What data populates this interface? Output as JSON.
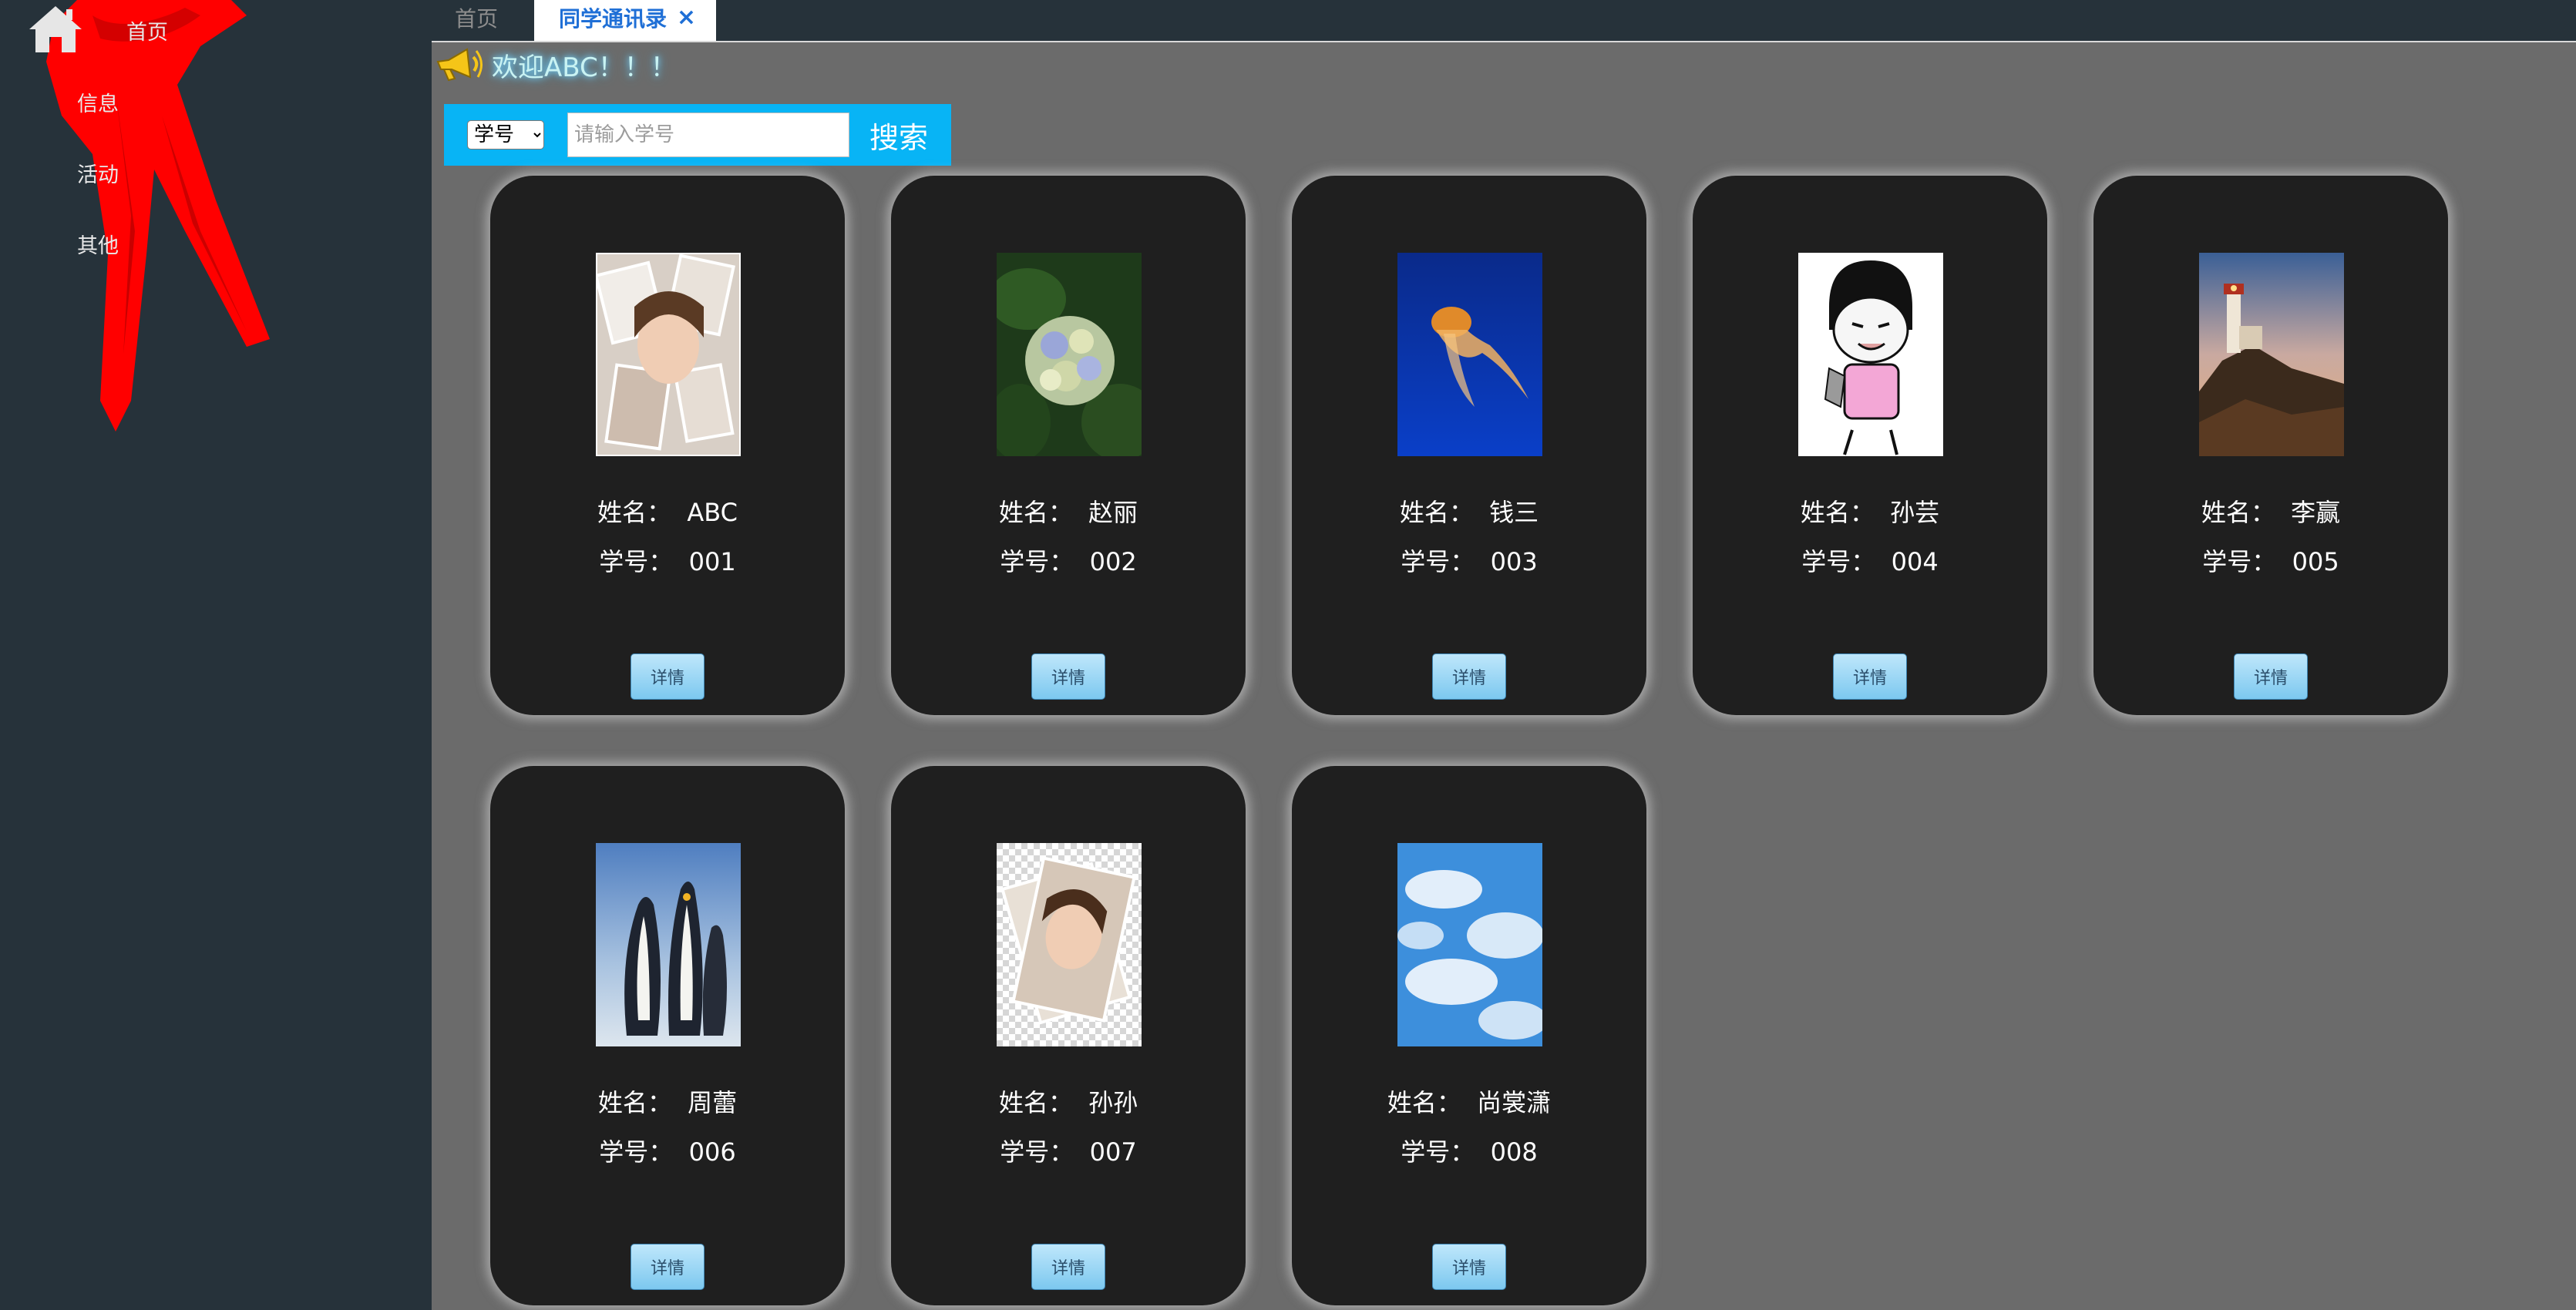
{
  "sidebar": {
    "items": [
      {
        "label": "首页"
      },
      {
        "label": "信息"
      },
      {
        "label": "活动"
      },
      {
        "label": "其他"
      }
    ]
  },
  "tabs": {
    "home": "首页",
    "active": "同学通讯录",
    "close": "×"
  },
  "welcome": {
    "text": "欢迎ABC！！！"
  },
  "search": {
    "field_options": [
      "学号"
    ],
    "selected": "学号",
    "placeholder": "请输入学号",
    "button": "搜索"
  },
  "colors": {
    "sidebar_bg": "#26323a",
    "main_bg": "#6b6b6b",
    "card_bg": "#1f1f1f",
    "search_bar_bg": "#08b4f5",
    "active_tab_text": "#1f6fd6",
    "scarf_red": "#ff0000"
  },
  "labels": {
    "name": "姓名：",
    "student_id": "学号："
  },
  "students": [
    {
      "name": "ABC",
      "id": "001",
      "detail": "详情"
    },
    {
      "name": "赵丽",
      "id": "002",
      "detail": "详情"
    },
    {
      "name": "钱三",
      "id": "003",
      "detail": "详情"
    },
    {
      "name": "孙芸",
      "id": "004",
      "detail": "详情"
    },
    {
      "name": "李赢",
      "id": "005",
      "detail": "详情"
    },
    {
      "name": "周蕾",
      "id": "006",
      "detail": "详情"
    },
    {
      "name": "孙孙",
      "id": "007",
      "detail": "详情"
    },
    {
      "name": "尚裳潇",
      "id": "008",
      "detail": "详情"
    }
  ]
}
